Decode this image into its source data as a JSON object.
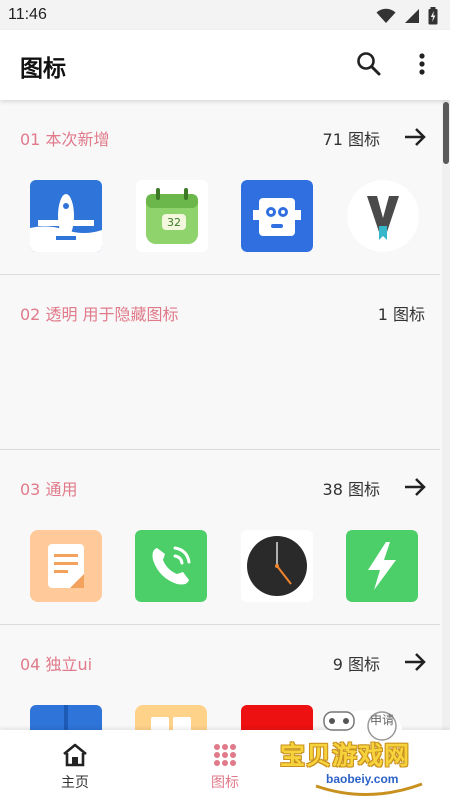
{
  "status_bar": {
    "time": "11:46"
  },
  "app_bar": {
    "title": "图标"
  },
  "sections": [
    {
      "title": "01 本次新增",
      "count": "71 图标",
      "icons": [
        "airplane-app-icon",
        "calendar-app-icon",
        "robot-app-icon",
        "v-bookmark-app-icon"
      ]
    },
    {
      "title": "02 透明 用于隐藏图标",
      "count": "1 图标",
      "icons": []
    },
    {
      "title": "03 通用",
      "count": "38 图标",
      "icons": [
        "notes-app-icon",
        "phone-app-icon",
        "clock-app-icon",
        "lightning-app-icon"
      ]
    },
    {
      "title": "04 独立ui",
      "count": "9 图标",
      "icons": [
        "blue-app-icon",
        "orange-app-icon",
        "red-app-icon"
      ]
    }
  ],
  "bottom_nav": {
    "items": [
      {
        "label": "主页",
        "icon": "home-icon",
        "active": false
      },
      {
        "label": "图标",
        "icon": "grid-icon",
        "active": true
      }
    ]
  },
  "watermark": {
    "text": "宝贝游戏网",
    "url": "baobeiy.com",
    "partial_label": "申请"
  },
  "colors": {
    "accent": "#e07a8a",
    "background": "#f8f8f8",
    "appbar": "#ffffff"
  }
}
